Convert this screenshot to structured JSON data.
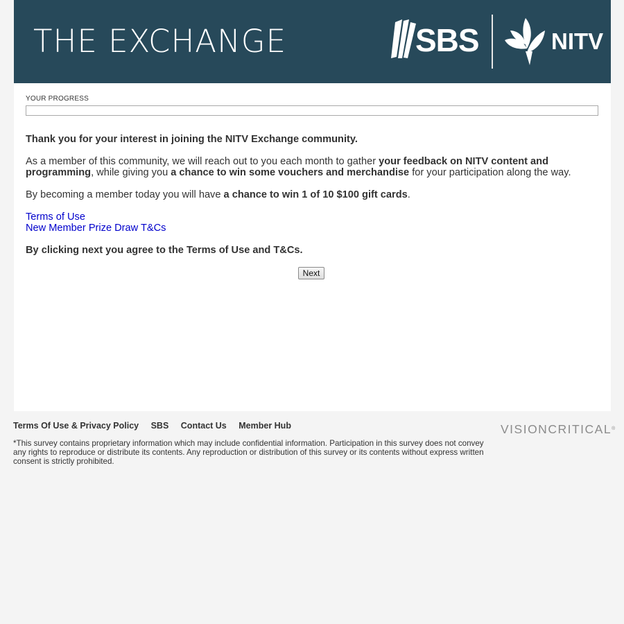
{
  "header": {
    "title": "THE EXCHANGE",
    "sbs_logo_text": "SBS",
    "nitv_logo_text": "NITV",
    "background_color": "#27495a"
  },
  "progress": {
    "label": "YOUR PROGRESS",
    "fraction": 0
  },
  "intro": {
    "heading": "Thank you for your interest in joining the NITV Exchange community.",
    "para1_part1": "As a member of this community, we will reach out to you each month to gather ",
    "para1_bold1": "your feedback on NITV content and programming",
    "para1_part2": ", while giving you ",
    "para1_bold2": "a chance to win some vouchers and merchandise",
    "para1_part3": " for your participation along the way.",
    "para2_part1": "By becoming a member today you will have ",
    "para2_bold": "a chance to win 1 of 10 $100 gift cards",
    "para2_part2": ".",
    "link_terms": "Terms of Use",
    "link_prize": "New Member Prize Draw T&Cs",
    "agreement": "By clicking next you agree to the Terms of Use and T&Cs."
  },
  "buttons": {
    "next": "Next"
  },
  "footer": {
    "links": [
      "Terms Of Use & Privacy Policy",
      "SBS",
      "Contact Us",
      "Member Hub"
    ],
    "note": "*This survey contains proprietary information which may include confidential information. Participation in this survey does not convey any rights to reproduce or distribute its contents. Any reproduction or distribution of this survey or its contents without express written consent is strictly prohibited.",
    "brand": "VISIONCRITICAL",
    "brand_mark": "®"
  }
}
